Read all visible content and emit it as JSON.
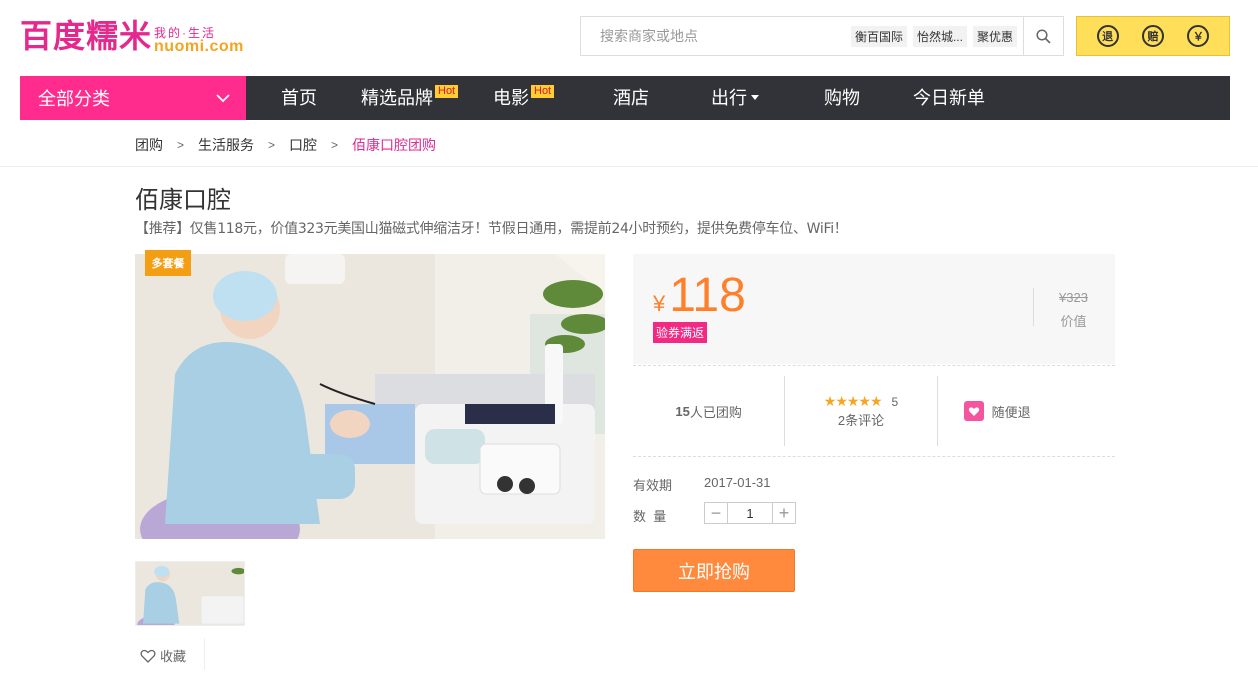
{
  "header": {
    "logo_main": "百度糯米",
    "logo_tag": "我的·生活",
    "logo_sub": "nuomi.com",
    "search_placeholder": "搜索商家或地点",
    "hot_words": [
      "衡百国际",
      "怡然城...",
      "聚优惠"
    ],
    "promises": [
      "退",
      "赔",
      "￥"
    ]
  },
  "nav": {
    "category_label": "全部分类",
    "items": [
      {
        "label": "首页",
        "hot": ""
      },
      {
        "label": "精选品牌",
        "hot": "Hot"
      },
      {
        "label": "电影",
        "hot": "Hot"
      },
      {
        "label": "酒店",
        "hot": ""
      },
      {
        "label": "出行",
        "hot": ""
      },
      {
        "label": "购物",
        "hot": ""
      },
      {
        "label": "今日新单",
        "hot": ""
      }
    ]
  },
  "breadcrumb": [
    "团购",
    "生活服务",
    "口腔",
    "佰康口腔团购"
  ],
  "deal": {
    "title": "佰康口腔",
    "subtitle": "【推荐】仅售118元，价值323元美国山猫磁式伸缩洁牙！节假日通用，需提前24小时预约，提供免费停车位、WiFi！",
    "badge": "多套餐",
    "favorite": "收藏",
    "currency": "¥",
    "price": "118",
    "refund_tag": "验券满返",
    "original_price": "¥323",
    "original_label": "价值",
    "sold": "15",
    "sold_suffix": "人已团购",
    "stars": "★★★★★",
    "score": "5",
    "reviews": "2条评论",
    "refund_text": "随便退",
    "valid_label": "有效期",
    "valid_date": "2017-01-31",
    "qty_label": "数  量",
    "qty_value": "1",
    "buy_label": "立即抢购"
  },
  "colors": {
    "brand_pink": "#ff2c8d",
    "price_orange": "#ff7f2a",
    "nav_dark": "#323339",
    "promise_yellow": "#ffde59"
  }
}
